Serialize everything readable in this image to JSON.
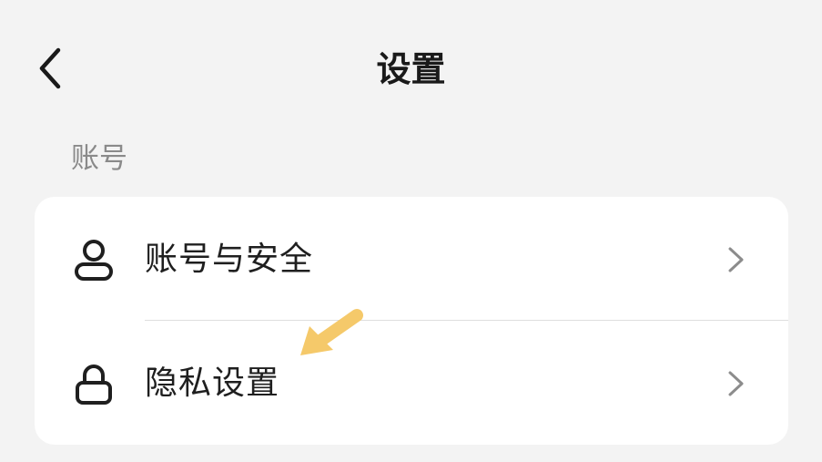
{
  "header": {
    "title": "设置"
  },
  "icons": {
    "back": "back-chevron-icon",
    "account": "person-icon",
    "privacy": "lock-icon",
    "chevron": "chevron-right-icon",
    "annotation": "pointer-arrow-icon"
  },
  "section": {
    "label": "账号"
  },
  "rows": [
    {
      "label": "账号与安全"
    },
    {
      "label": "隐私设置"
    }
  ],
  "colors": {
    "background": "#f3f3f3",
    "card": "#ffffff",
    "annotation_arrow": "#f5c96a"
  }
}
